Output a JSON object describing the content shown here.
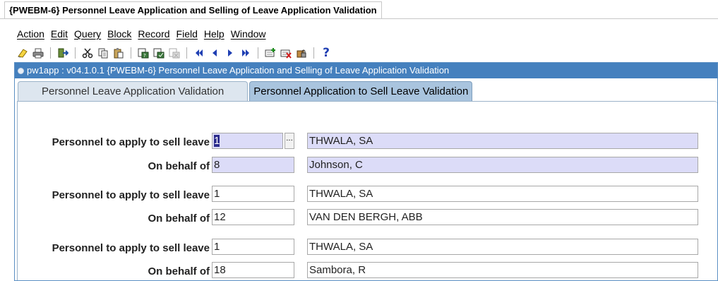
{
  "window": {
    "title": "{PWEBM-6} Personnel Leave Application and Selling of Leave Application Validation"
  },
  "menu": [
    "Action",
    "Edit",
    "Query",
    "Block",
    "Record",
    "Field",
    "Help",
    "Window"
  ],
  "toolbar": {
    "icons": [
      "save-icon",
      "print-icon",
      "exit-icon",
      "cut-icon",
      "copy-icon",
      "paste-icon",
      "enter-query-icon",
      "execute-query-icon",
      "cancel-query-icon",
      "first-record-icon",
      "previous-record-icon",
      "next-record-icon",
      "last-record-icon",
      "insert-record-icon",
      "delete-record-icon",
      "lock-record-icon",
      "help-icon"
    ],
    "help_glyph": "?"
  },
  "frame": {
    "title": "pw1app : v04.1.0.1 {PWEBM-6} Personnel Leave Application and Selling of Leave Application Validation"
  },
  "tabs": [
    {
      "label": "Personnel Leave Application Validation",
      "active": false
    },
    {
      "label": "Personnel Application to Sell Leave Validation",
      "active": true
    }
  ],
  "form": {
    "lov_glyph": "...",
    "records": [
      {
        "personnel_label": "Personnel to apply to sell leave",
        "personnel_no": "1",
        "personnel_name": "THWALA, SA",
        "behalf_label": "On behalf of",
        "behalf_no": "8",
        "behalf_name": "Johnson, C"
      },
      {
        "personnel_label": "Personnel to apply to sell leave",
        "personnel_no": "1",
        "personnel_name": "THWALA, SA",
        "behalf_label": "On behalf of",
        "behalf_no": "12",
        "behalf_name": "VAN DEN BERGH, ABB"
      },
      {
        "personnel_label": "Personnel to apply to sell leave",
        "personnel_no": "1",
        "personnel_name": "THWALA, SA",
        "behalf_label": "On behalf of",
        "behalf_no": "18",
        "behalf_name": "Sambora, R"
      }
    ]
  },
  "colors": {
    "frame_title_bg": "#4580be",
    "active_tab_bg": "#a9c4de",
    "current_record_bg": "#dcdcf8"
  }
}
